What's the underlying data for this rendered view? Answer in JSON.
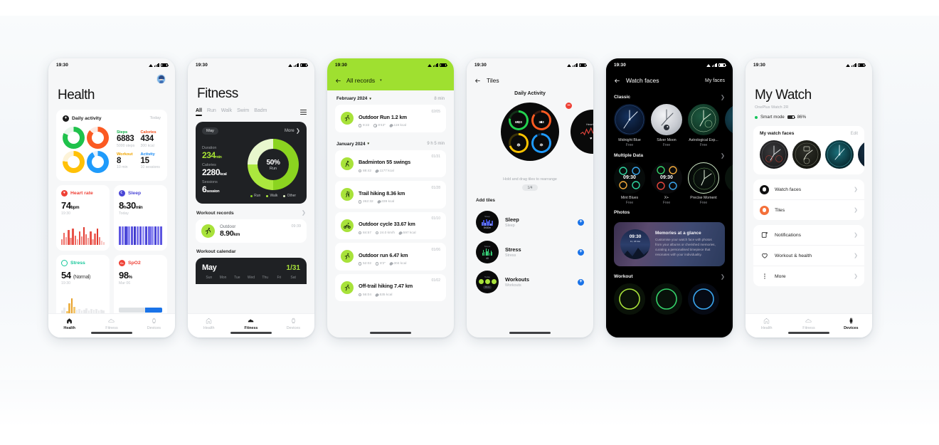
{
  "status_bar": {
    "time": "19:30",
    "battery_pct": "86%"
  },
  "phone1": {
    "title": "Health",
    "daily": {
      "label": "Daily activity",
      "period": "Today",
      "stats": [
        {
          "label": "Steps",
          "value": "6883",
          "sub": "5000 steps",
          "color": "#12b24a"
        },
        {
          "label": "Calories",
          "value": "434",
          "sub": "300 kcal",
          "color": "#f4511e"
        },
        {
          "label": "Workout",
          "value": "8",
          "sub": "10 min",
          "color": "#f0a500"
        },
        {
          "label": "Activity",
          "value": "15",
          "sub": "10 sessions",
          "color": "#1789f2"
        }
      ]
    },
    "metrics": [
      {
        "name": "Heart rate",
        "value": "74",
        "unit": "bpm",
        "time": "19:30",
        "color": "#ef4136",
        "icon": "heart-icon"
      },
      {
        "name": "Sleep",
        "value": "8",
        "unit": "h",
        "value2": "30",
        "unit2": "min",
        "time": "Today",
        "color": "#4a46d6",
        "icon": "moon-icon"
      },
      {
        "name": "Stress",
        "value": "54",
        "unit": "(Normal)",
        "time": "19:30",
        "color": "#16c79a",
        "icon": "stress-icon"
      },
      {
        "name": "SpO2",
        "value": "98",
        "unit": "%",
        "time": "Mar 06",
        "color": "#ef4136",
        "icon": "o2-icon"
      }
    ],
    "tabs": [
      {
        "label": "Health",
        "icon": "home-icon",
        "active": true
      },
      {
        "label": "Fitness",
        "icon": "shoe-icon",
        "active": false
      },
      {
        "label": "Devices",
        "icon": "watch-icon",
        "active": false
      }
    ]
  },
  "phone2": {
    "title": "Fitness",
    "filter_tabs": [
      "All",
      "Run",
      "Walk",
      "Swim",
      "Badm"
    ],
    "active_filter": "All",
    "summary": {
      "month_chip": "May",
      "more": "More",
      "duration_label": "Duration",
      "duration_value": "234",
      "duration_unit": "min",
      "calories_label": "Calories",
      "calories_value": "2280",
      "calories_unit": "kcal",
      "sessions_label": "Sessions",
      "sessions_value": "6",
      "sessions_unit": "session",
      "donut_pct": "50%",
      "donut_label": "Run",
      "legend": [
        {
          "label": "Run",
          "color": "#8bd420"
        },
        {
          "label": "Walk",
          "color": "#abe83e"
        },
        {
          "label": "Other",
          "color": "#e8f7cd"
        }
      ]
    },
    "records_heading": "Workout records",
    "record": {
      "type": "Outdoor",
      "value": "8.90",
      "unit": "km",
      "time": "09:39"
    },
    "calendar_heading": "Workout calendar",
    "calendar": {
      "month": "May",
      "count": "1/31",
      "days": [
        "Sun",
        "Mon",
        "Tue",
        "Wed",
        "Thu",
        "Fri",
        "Sat"
      ]
    },
    "tabs": [
      {
        "label": "Health",
        "icon": "home-icon",
        "active": false
      },
      {
        "label": "Fitness",
        "icon": "shoe-icon",
        "active": true
      },
      {
        "label": "Devices",
        "icon": "watch-icon",
        "active": false
      }
    ]
  },
  "phone3": {
    "header_title": "All records",
    "sections": [
      {
        "label": "February 2024",
        "total": "8 min",
        "records": [
          {
            "name": "Outdoor Run 1.2 km",
            "date": "02/05",
            "metrics": [
              "8:22",
              "8'43\"",
              "119 kcal"
            ],
            "icon": "run-icon"
          }
        ]
      },
      {
        "label": "January 2024",
        "total": "9 h 5 min",
        "records": [
          {
            "name": "Badminton 55 swings",
            "date": "01/31",
            "metrics": [
              "88:42",
              "1177 kcal"
            ],
            "icon": "badminton-icon"
          },
          {
            "name": "Trail hiking 8.36 km",
            "date": "01/28",
            "metrics": [
              "262:32",
              "339 kcal"
            ],
            "icon": "hike-icon"
          },
          {
            "name": "Outdoor cycle 33.67 km",
            "date": "01/10",
            "metrics": [
              "84:57",
              "24.0 km/h",
              "597 kcal"
            ],
            "icon": "cycle-icon"
          },
          {
            "name": "Outdoor run 6.47 km",
            "date": "01/06",
            "metrics": [
              "52:02",
              "8'2\"",
              "304 kcal"
            ],
            "icon": "run-icon"
          },
          {
            "name": "Off-trail hiking 7.47 km",
            "date": "01/02",
            "metrics": [
              "56:04",
              "535 kcal"
            ],
            "icon": "run-icon"
          }
        ]
      }
    ]
  },
  "phone4": {
    "header_title": "Tiles",
    "current_tile": "Daily Activity",
    "hint": "Hold and drag tiles to rearrange",
    "pager": "1/4",
    "activity_rings": [
      {
        "value": "6003",
        "color": "#23d24f",
        "icon": "steps-icon"
      },
      {
        "value": "303",
        "color": "#ff5b22",
        "icon": "flame-icon"
      },
      {
        "value": "36",
        "color": "#ffc400",
        "icon": "clock-icon"
      },
      {
        "value": "12",
        "color": "#1f9bff",
        "icon": "stand-icon"
      }
    ],
    "add_tiles_heading": "Add tiles",
    "available": [
      {
        "name": "Sleep",
        "sub": "Sleep"
      },
      {
        "name": "Stress",
        "sub": "Stress"
      },
      {
        "name": "Workouts",
        "sub": "Workouts"
      }
    ]
  },
  "phone5": {
    "header_title": "Watch faces",
    "my_faces": "My faces",
    "sections": [
      {
        "label": "Classic",
        "faces": [
          {
            "name": "Midnight Blue",
            "price": "Free"
          },
          {
            "name": "Silver Moon",
            "price": "Free"
          },
          {
            "name": "Astrological Exp...",
            "price": "Free"
          }
        ]
      },
      {
        "label": "Multiple Data",
        "faces": [
          {
            "name": "Mint Blues",
            "price": "Free"
          },
          {
            "name": "X+",
            "price": "Free"
          },
          {
            "name": "Precise Moment",
            "price": "Free"
          }
        ]
      }
    ],
    "photos_label": "Photos",
    "photo_card": {
      "title": "Memories at a glance",
      "body": "Customise your watch face with photos from your albums or cherished memories, curating a personalised timepiece that resonates with your individuality.",
      "watch_time": "09:30"
    },
    "workout_label": "Workout"
  },
  "phone6": {
    "title": "My Watch",
    "device": "OnePlus Watch 2R",
    "mode": "Smart mode",
    "battery": "86%",
    "faces_heading": "My watch faces",
    "edit": "Edit",
    "menu": [
      {
        "label": "Watch faces",
        "icon": "watch-face-icon"
      },
      {
        "label": "Tiles",
        "icon": "tiles-icon"
      },
      {
        "label": "Notifications",
        "icon": "notification-icon"
      },
      {
        "label": "Workout & health",
        "icon": "heart-outline-icon"
      },
      {
        "label": "More",
        "icon": "more-icon"
      }
    ],
    "tabs": [
      {
        "label": "Health",
        "icon": "home-icon",
        "active": false
      },
      {
        "label": "Fitness",
        "icon": "shoe-icon",
        "active": false
      },
      {
        "label": "Devices",
        "icon": "watch-icon",
        "active": true
      }
    ]
  }
}
